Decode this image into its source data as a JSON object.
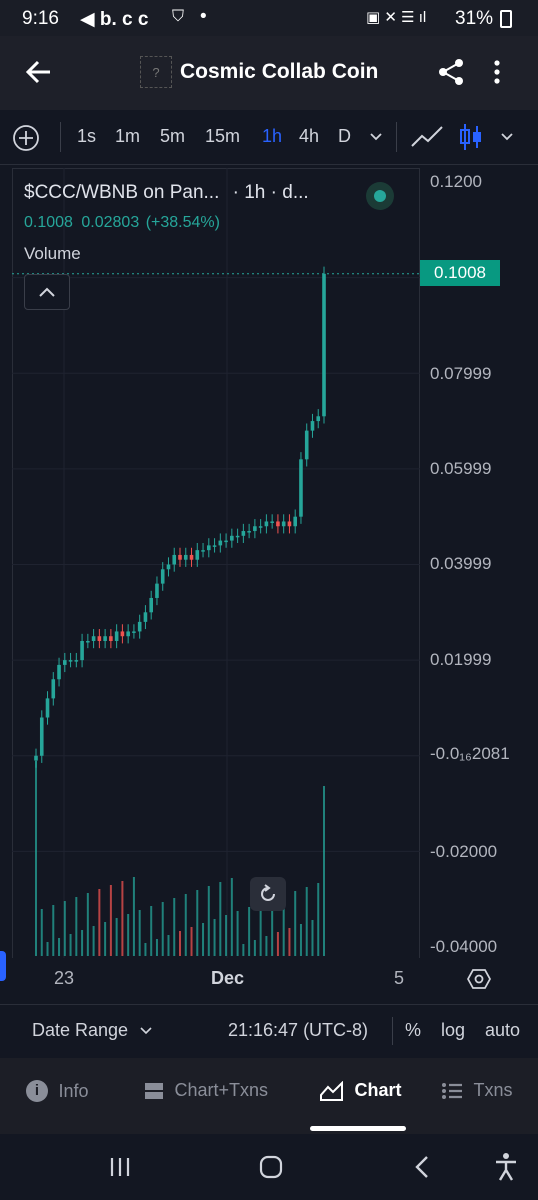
{
  "status": {
    "time": "9:16",
    "left_icons": "◀ b. c c",
    "battery": "31%"
  },
  "appbar": {
    "title": "Cosmic Collab Coin",
    "logo_placeholder": "?"
  },
  "toolbar": {
    "timeframes": [
      "1s",
      "1m",
      "5m",
      "15m",
      "1h",
      "4h",
      "D"
    ],
    "active_timeframe": "1h"
  },
  "legend": {
    "pair": "$CCC/WBNB on Pan...",
    "interval": "· 1h · d...",
    "close": "0.1008",
    "change": "0.02803",
    "change_pct": "(+38.54%)",
    "volume_label": "Volume"
  },
  "price_axis": {
    "labels": [
      "0.1200",
      "0.07999",
      "0.05999",
      "0.03999",
      "0.01999",
      "-0.0₁₆2081",
      "-0.02000",
      "-0.04000"
    ],
    "last_price": "0.1008"
  },
  "time_axis": {
    "labels": [
      "23",
      "Dec",
      "5"
    ]
  },
  "bottom": {
    "date_range": "Date Range",
    "clock": "21:16:47 (UTC-8)",
    "percent": "%",
    "log": "log",
    "auto": "auto"
  },
  "nav": {
    "items": [
      "Info",
      "Chart+Txns",
      "Chart",
      "Txns"
    ],
    "active": "Chart"
  },
  "colors": {
    "up": "#26a69a",
    "down": "#ef5350",
    "accent": "#2962ff",
    "bg": "#131722"
  },
  "chart_data": {
    "type": "candlestick",
    "ylim": [
      -0.04,
      0.12
    ],
    "close_series": [
      0.0,
      0.008,
      0.012,
      0.016,
      0.019,
      0.02,
      0.02,
      0.02,
      0.024,
      0.024,
      0.025,
      0.024,
      0.025,
      0.024,
      0.026,
      0.025,
      0.026,
      0.026,
      0.028,
      0.03,
      0.033,
      0.036,
      0.039,
      0.04,
      0.042,
      0.041,
      0.042,
      0.041,
      0.043,
      0.043,
      0.044,
      0.044,
      0.045,
      0.045,
      0.046,
      0.046,
      0.047,
      0.047,
      0.048,
      0.048,
      0.049,
      0.049,
      0.048,
      0.049,
      0.048,
      0.05,
      0.062,
      0.068,
      0.07,
      0.071,
      0.1008
    ]
  }
}
